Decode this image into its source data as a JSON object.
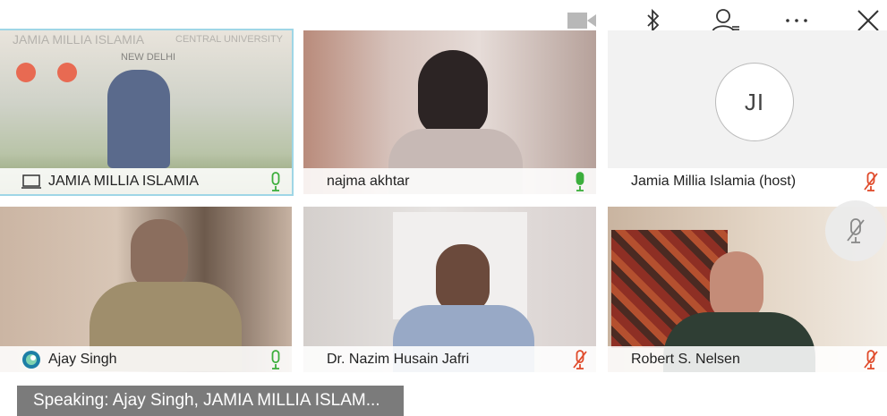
{
  "top_icons": [
    "video-camera-icon",
    "bluetooth-icon",
    "participants-icon",
    "more-icon",
    "close-icon"
  ],
  "tiles": [
    {
      "name": "JAMIA MILLIA ISLAMIA",
      "lead_icon": "laptop-icon",
      "mic": "unmuted",
      "watermark": [
        "JAMIA MILLIA ISLAMIA",
        "CENTRAL UNIVERSITY",
        "NEW DELHI"
      ]
    },
    {
      "name": "najma akhtar",
      "mic": "unmuted"
    },
    {
      "name": "Jamia Millia Islamia (host)",
      "avatar": "JI",
      "mic": "muted"
    },
    {
      "name": "Ajay Singh",
      "lead_icon": "app-logo-icon",
      "mic": "unmuted"
    },
    {
      "name": "Dr. Nazim Husain Jafri",
      "mic": "muted"
    },
    {
      "name": "Robert S. Nelsen",
      "mic": "muted"
    }
  ],
  "speaking": "Speaking: Ajay Singh, JAMIA MILLIA ISLAM...",
  "colors": {
    "mic_on": "#3cae3c",
    "mic_off": "#e04b2b",
    "accent": "#9fd6e6"
  }
}
